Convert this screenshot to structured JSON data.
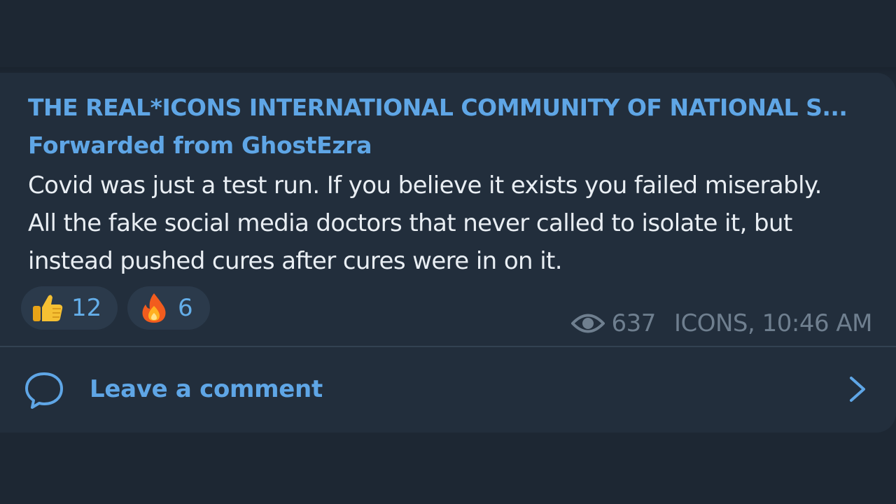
{
  "post": {
    "channel_name": "THE REAL*ICONS INTERNATIONAL COMMUNITY OF NATIONAL S...",
    "forwarded_from": "Forwarded from GhostEzra",
    "text_lines": [
      "Covid was just a test run. If you believe it exists you failed miserably.",
      "All the fake social media doctors that never called to isolate it, but",
      "instead pushed cures after cures were in on it."
    ],
    "reactions": [
      {
        "emoji": "thumbs-up-icon",
        "count": "12"
      },
      {
        "emoji": "fire-icon",
        "count": "6"
      }
    ],
    "views": "637",
    "author_time": "ICONS, 10:46 AM"
  },
  "comments": {
    "label": "Leave a comment",
    "icon": "speech-bubble-icon",
    "chevron": "chevron-right-icon"
  },
  "colors": {
    "background": "#1d2733",
    "bubble": "#222e3c",
    "accent": "#5fa6e6",
    "text": "#e9eef3",
    "meta": "#6f7f8f",
    "reaction_bg": "#2b3a4b"
  }
}
